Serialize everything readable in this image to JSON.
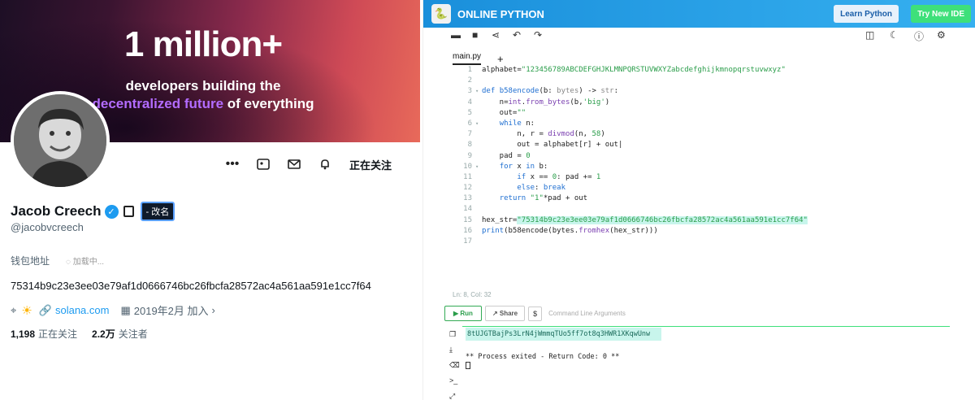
{
  "profile": {
    "banner": {
      "headline": "1 million+",
      "line1": "developers building the",
      "line2_highlight": "decentralized future",
      "line2_rest": " of everything"
    },
    "follow_label": "正在关注",
    "name": "Jacob Creech",
    "rename_label": "- 改名",
    "handle": "@jacobvcreech",
    "wallet_label": "钱包地址",
    "loading_label": "加载中...",
    "hex": "75314b9c23e3ee03e79af1d0666746bc26fbcfa28572ac4a561aa591e1cc7f64",
    "website": "solana.com",
    "joined": "2019年2月 加入",
    "following_count": "1,198",
    "following_label": "正在关注",
    "followers_count": "2.2万",
    "followers_label": "关注者"
  },
  "ide": {
    "brand": "ONLINE PYTHON",
    "learn_label": "Learn Python",
    "try_label": "Try New IDE",
    "tab": "main.py",
    "status": "Ln: 8,  Col: 32",
    "run_label": "Run",
    "share_label": "Share",
    "cla_placeholder": "Command Line Arguments",
    "output_result": "8tUJGTBajPs3LrN4jWmmqTUo5ff7ot8q3HWR1XKqwUnw",
    "output_exit": "** Process exited - Return Code: 0 **"
  },
  "icons": {
    "more": "more-icon",
    "gallery": "gallery-icon",
    "mail": "mail-icon",
    "bell": "bell-icon",
    "location": "location-icon",
    "sun": "sun-icon",
    "link": "link-icon",
    "calendar": "calendar-icon"
  },
  "colors": {
    "accent_blue": "#1d9bf0",
    "ide_bar": "#1a8fdb",
    "run_green": "#2a9d4a",
    "highlight": "#c8f5ec"
  }
}
